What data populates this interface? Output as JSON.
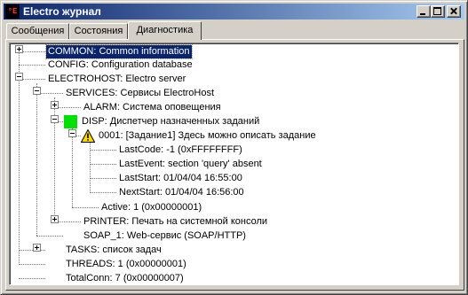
{
  "window": {
    "title": "Electro журнал",
    "icon": "electro-app-icon",
    "icon_text": "°E",
    "caption_buttons": [
      "minimize",
      "maximize",
      "close"
    ]
  },
  "tabs": {
    "messages": "Сообщения",
    "states": "Состояния",
    "diagnostics": "Диагностика",
    "active": "Диагностика"
  },
  "tree": {
    "common": "COMMON: Common information",
    "config": "CONFIG: Configuration database",
    "electrohost": "ELECTROHOST: Electro server",
    "services": "SERVICES: Сервисы ElectroHost",
    "alarm": "ALARM: Система оповещения",
    "disp": "DISP: Диспетчер назначенных заданий",
    "task": "0001: [Задание1] Здесь можно описать задание",
    "lastcode": "LastCode: -1 (0xFFFFFFFF)",
    "lastevent": "LastEvent: section 'query' absent",
    "laststart": "LastStart: 01/04/04 16:55:00",
    "nextstart": "NextStart: 01/04/04 16:56:00",
    "active": "Active: 1 (0x00000001)",
    "printer": "PRINTER: Печать на системной консоли",
    "soap": "SOAP_1: Web-сервис (SOAP/HTTP)",
    "tasks": "TASKS: список задач",
    "threads": "THREADS: 1 (0x00000001)",
    "totalconn": "TotalConn: 7 (0x00000007)"
  },
  "colors": {
    "title_gradient_start": "#0a246a",
    "title_gradient_end": "#a6caf0",
    "selection": "#0a246a",
    "status_ok": "#00e000",
    "warning": "#ffd800"
  }
}
